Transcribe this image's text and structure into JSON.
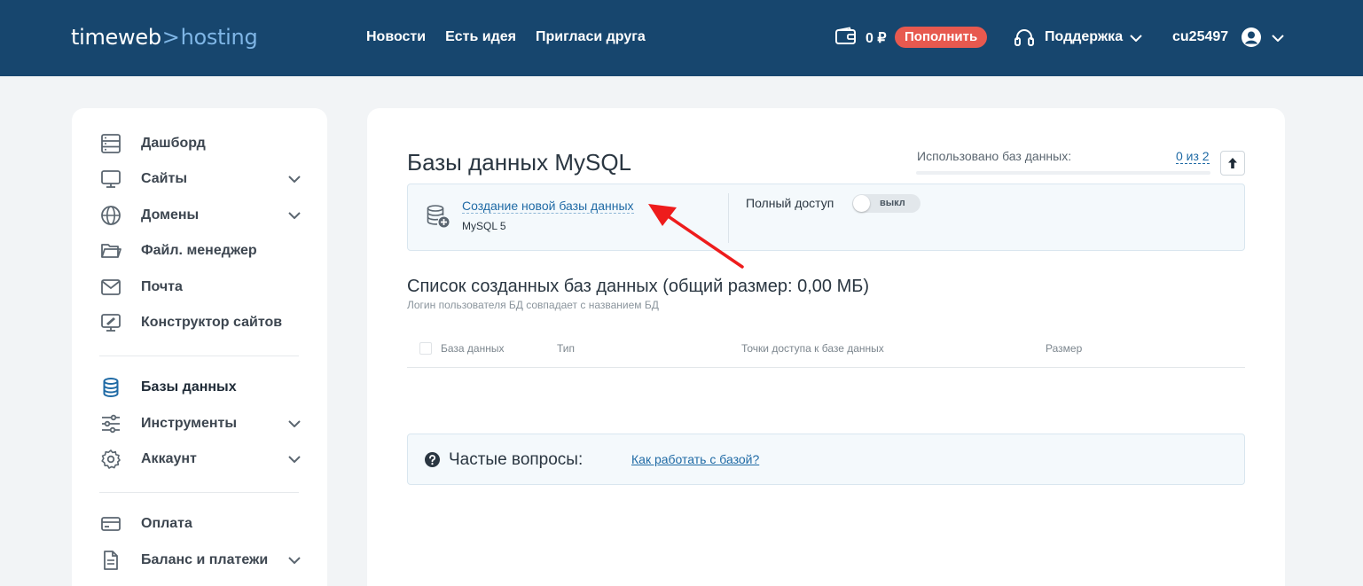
{
  "header": {
    "logo": {
      "brand": "timeweb",
      "separator": ">",
      "product": "hosting"
    },
    "nav": [
      "Новости",
      "Есть идея",
      "Пригласи друга"
    ],
    "balance": "0 ₽",
    "topup_label": "Пополнить",
    "support_label": "Поддержка",
    "username": "cu25497",
    "icons": [
      "wallet-icon",
      "headset-icon",
      "user-avatar-icon",
      "chevron-down-icon"
    ]
  },
  "sidebar": {
    "items": [
      {
        "label": "Дашборд",
        "icon": "dashboard-icon",
        "expandable": false
      },
      {
        "label": "Сайты",
        "icon": "monitor-icon",
        "expandable": true
      },
      {
        "label": "Домены",
        "icon": "globe-icon",
        "expandable": true
      },
      {
        "label": "Файл. менеджер",
        "icon": "folder-icon",
        "expandable": false
      },
      {
        "label": "Почта",
        "icon": "mail-icon",
        "expandable": false
      },
      {
        "label": "Конструктор сайтов",
        "icon": "site-builder-icon",
        "expandable": false
      },
      {
        "label": "Базы данных",
        "icon": "database-icon",
        "expandable": false,
        "active": true
      },
      {
        "label": "Инструменты",
        "icon": "sliders-icon",
        "expandable": true
      },
      {
        "label": "Аккаунт",
        "icon": "gear-icon",
        "expandable": true
      },
      {
        "label": "Оплата",
        "icon": "card-icon",
        "expandable": false
      },
      {
        "label": "Баланс и платежи",
        "icon": "document-icon",
        "expandable": true
      }
    ]
  },
  "main": {
    "title": "Базы данных MySQL",
    "usage": {
      "label": "Использовано баз данных:",
      "count_text": "0 из 2",
      "used": 0,
      "total": 2
    },
    "create": {
      "link": "Создание новой базы данных",
      "subtitle": "MySQL 5"
    },
    "access": {
      "label": "Полный доступ",
      "toggle_label": "выкл",
      "enabled": false
    },
    "list": {
      "title": "Список созданных баз данных (общий размер: 0,00 МБ)",
      "note": "Логин пользователя БД совпадает с названием БД",
      "columns": [
        "База данных",
        "Тип",
        "Точки доступа к базе данных",
        "Размер"
      ],
      "rows": []
    },
    "faq": {
      "label": "Частые вопросы:",
      "link": "Как работать с базой?"
    }
  },
  "colors": {
    "header_bg": "#17466e",
    "accent_link": "#1f6aa5",
    "topup_bg": "#e7594f",
    "annotation_arrow": "#ee1c1c"
  }
}
